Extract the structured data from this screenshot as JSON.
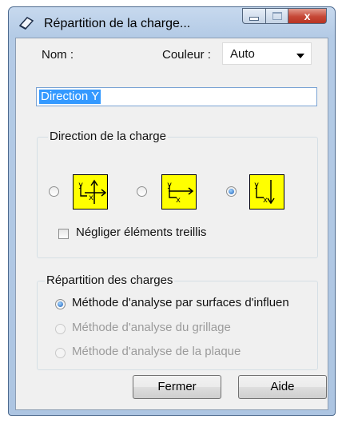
{
  "window": {
    "title": "Répartition de la charge...",
    "close_glyph": "x"
  },
  "form": {
    "name_label": "Nom :",
    "color_label": "Couleur :",
    "color_value": "Auto",
    "name_value": "Direction Y"
  },
  "direction_group": {
    "title": "Direction de la charge",
    "options": [
      {
        "icon": "load-direction-xy-icon",
        "selected": false
      },
      {
        "icon": "load-direction-x-icon",
        "selected": false
      },
      {
        "icon": "load-direction-y-icon",
        "selected": true
      }
    ],
    "axis_labels": {
      "y": "y",
      "x": "x"
    },
    "ignore_truss_label": "Négliger éléments treillis",
    "ignore_truss_checked": false
  },
  "distribution_group": {
    "title": "Répartition des charges",
    "options": [
      {
        "label": "Méthode d'analyse par surfaces d'influen",
        "selected": true,
        "enabled": true
      },
      {
        "label": "Méthode d'analyse du grillage",
        "selected": false,
        "enabled": false
      },
      {
        "label": "Méthode d'analyse de la plaque",
        "selected": false,
        "enabled": false
      }
    ]
  },
  "buttons": {
    "close": "Fermer",
    "help": "Aide"
  },
  "colors": {
    "icon_fill": "#ffff00",
    "title_bar": "#b4cbe6",
    "close_button": "#c64736",
    "selection": "#3399ff"
  }
}
